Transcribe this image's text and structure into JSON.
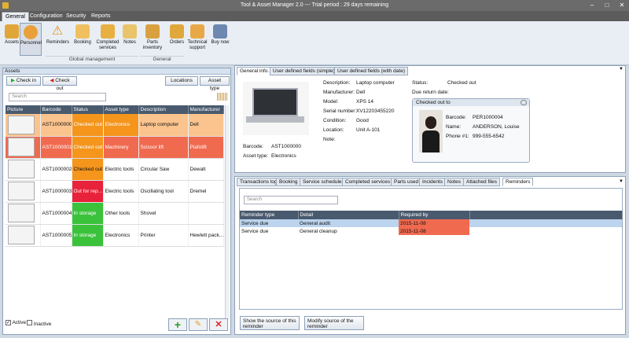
{
  "window": {
    "title": "Tool & Asset Manager 2.0 --- Trial period : 29 days remaining"
  },
  "menu": {
    "tabs": [
      "General",
      "Configuration",
      "Security",
      "Reports"
    ]
  },
  "ribbon": {
    "buttons": [
      {
        "label": "Assets",
        "icon": "assets-icon"
      },
      {
        "label": "Personnel",
        "icon": "personnel-icon"
      },
      {
        "label": "Reminders",
        "icon": "warning-icon"
      },
      {
        "label": "Booking",
        "icon": "booking-icon"
      },
      {
        "label": "Completed services",
        "icon": "completed-services-icon"
      },
      {
        "label": "Notes",
        "icon": "notes-icon"
      },
      {
        "label": "Parts inventory",
        "icon": "parts-icon"
      },
      {
        "label": "Orders",
        "icon": "orders-icon"
      },
      {
        "label": "Technical support",
        "icon": "support-icon"
      },
      {
        "label": "Buy now",
        "icon": "buy-icon"
      }
    ],
    "groups": [
      "Global management",
      "General"
    ]
  },
  "assets": {
    "header": "Assets",
    "checkin": "Check in",
    "checkout": "Check out",
    "locations": "Locations",
    "asset_type": "Asset type",
    "search_placeholder": "Search",
    "columns": [
      "Picture",
      "Barcode",
      "Status",
      "Asset type",
      "Description",
      "Manufacturer"
    ],
    "rows": [
      {
        "barcode": "AST1000000",
        "status": "Checked out",
        "type": "Electronics",
        "description": "Laptop computer",
        "manufacturer": "Dell"
      },
      {
        "barcode": "AST1000001",
        "status": "Checked out",
        "type": "Machinery",
        "description": "Scissor lift",
        "manufacturer": "Piafolift"
      },
      {
        "barcode": "AST1000002",
        "status": "Checked out",
        "type": "Electric tools",
        "description": "Circular Saw",
        "manufacturer": "Dewalt"
      },
      {
        "barcode": "AST1000003",
        "status": "Out for rep...",
        "type": "Electric tools",
        "description": "Oscillating tool",
        "manufacturer": "Dremel"
      },
      {
        "barcode": "AST1000004",
        "status": "In storage",
        "type": "Other tools",
        "description": "Shovel",
        "manufacturer": ""
      },
      {
        "barcode": "AST1000005",
        "status": "In storage",
        "type": "Electronics",
        "description": "Printer",
        "manufacturer": "Hewlett pack..."
      }
    ],
    "active_label": "Active",
    "inactive_label": "Inactive"
  },
  "detail": {
    "tabs": [
      "General info.",
      "User defined fields (simple)",
      "User defined fields (with date)"
    ],
    "fields": [
      {
        "k": "Description:",
        "v": "Laptop computer"
      },
      {
        "k": "Manufacturer:",
        "v": "Dell"
      },
      {
        "k": "Model:",
        "v": "XPS 14"
      },
      {
        "k": "Serial number:",
        "v": "XV12203455220"
      },
      {
        "k": "Condition:",
        "v": "Good"
      },
      {
        "k": "Location:",
        "v": "Unit A-101"
      },
      {
        "k": "Note:",
        "v": ""
      }
    ],
    "barcode_label": "Barcode:",
    "barcode": "AST1000000",
    "assettype_label": "Asset type:",
    "assettype": "Electronics",
    "status_label": "Status:",
    "status": "Checked out",
    "due_label": "Due return date:",
    "checkedout_to": "Checked out to",
    "person": [
      {
        "k": "Barcode:",
        "v": "PER1000004"
      },
      {
        "k": "Name:",
        "v": "ANDERSON, Louise"
      },
      {
        "k": "Phone #1:",
        "v": "999-555-6542"
      }
    ]
  },
  "bottom": {
    "tabs": [
      "Transactions log",
      "Booking",
      "Service schedule",
      "Completed services",
      "Parts used",
      "Incidents",
      "Notes",
      "Attached files",
      "Reminders"
    ],
    "search_placeholder": "Search",
    "columns": [
      "Reminder type",
      "Detail",
      "Required by"
    ],
    "rows": [
      {
        "type": "Service due",
        "detail": "General audit",
        "date": "2015-11-08"
      },
      {
        "type": "Service due",
        "detail": "General cleanup",
        "date": "2015-11-08"
      }
    ],
    "show_source": "Show the source of this reminder",
    "modify_source": "Modify source of the reminder"
  },
  "colors": {
    "checked_out": "#f5951c",
    "out_for_repair": "#e8223a",
    "in_storage": "#3bc23b",
    "row_selected": "#fbc48e",
    "row_alert": "#f06a50",
    "due": "#f06a50"
  }
}
